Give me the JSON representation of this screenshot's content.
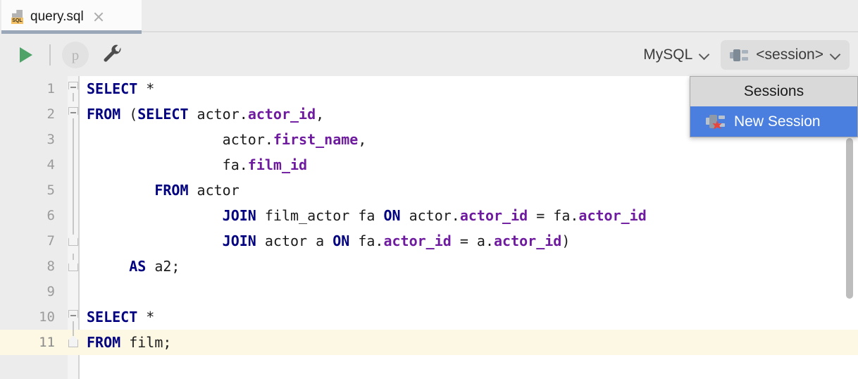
{
  "tab": {
    "filename": "query.sql",
    "icon": "sql-file-icon",
    "badge_text": "SQL",
    "close_icon": "close-icon"
  },
  "toolbar": {
    "run_icon": "run-play-icon",
    "parameters_label": "p",
    "settings_icon": "wrench-icon",
    "dialect_label": "MySQL",
    "dialect_chevron": "chevron-down-icon",
    "session_label": "<session>",
    "session_icon": "session-plug-icon",
    "session_chevron": "chevron-down-icon"
  },
  "dropdown": {
    "header": "Sessions",
    "items": [
      {
        "label": "New Session",
        "icon": "new-session-plug-star-icon",
        "selected": true
      }
    ]
  },
  "editor": {
    "current_line": 11,
    "lines": [
      {
        "n": "1",
        "fold": "minus",
        "tokens": [
          {
            "t": "SELECT",
            "c": "kw"
          },
          {
            "t": " *",
            "c": "pln"
          }
        ]
      },
      {
        "n": "2",
        "fold": "minus",
        "tokens": [
          {
            "t": "FROM",
            "c": "kw"
          },
          {
            "t": " (",
            "c": "pln"
          },
          {
            "t": "SELECT",
            "c": "kw"
          },
          {
            "t": " actor.",
            "c": "pln"
          },
          {
            "t": "actor_id",
            "c": "col"
          },
          {
            "t": ",",
            "c": "pln"
          }
        ]
      },
      {
        "n": "3",
        "fold": "line",
        "tokens": [
          {
            "t": "                actor.",
            "c": "pln"
          },
          {
            "t": "first_name",
            "c": "col"
          },
          {
            "t": ",",
            "c": "pln"
          }
        ]
      },
      {
        "n": "4",
        "fold": "line",
        "tokens": [
          {
            "t": "                fa.",
            "c": "pln"
          },
          {
            "t": "film_id",
            "c": "col"
          }
        ]
      },
      {
        "n": "5",
        "fold": "line",
        "tokens": [
          {
            "t": "        ",
            "c": "pln"
          },
          {
            "t": "FROM",
            "c": "kw"
          },
          {
            "t": " actor",
            "c": "pln"
          }
        ]
      },
      {
        "n": "6",
        "fold": "line",
        "tokens": [
          {
            "t": "                ",
            "c": "pln"
          },
          {
            "t": "JOIN",
            "c": "kw"
          },
          {
            "t": " film_actor fa ",
            "c": "pln"
          },
          {
            "t": "ON",
            "c": "kw"
          },
          {
            "t": " actor.",
            "c": "pln"
          },
          {
            "t": "actor_id",
            "c": "col"
          },
          {
            "t": " = fa.",
            "c": "pln"
          },
          {
            "t": "actor_id",
            "c": "col"
          }
        ]
      },
      {
        "n": "7",
        "fold": "end",
        "tokens": [
          {
            "t": "                ",
            "c": "pln"
          },
          {
            "t": "JOIN",
            "c": "kw"
          },
          {
            "t": " actor a ",
            "c": "pln"
          },
          {
            "t": "ON",
            "c": "kw"
          },
          {
            "t": " fa.",
            "c": "pln"
          },
          {
            "t": "actor_id",
            "c": "col"
          },
          {
            "t": " = a.",
            "c": "pln"
          },
          {
            "t": "actor_id",
            "c": "col"
          },
          {
            "t": ")",
            "c": "pln"
          }
        ]
      },
      {
        "n": "8",
        "fold": "end",
        "tokens": [
          {
            "t": "     ",
            "c": "pln"
          },
          {
            "t": "AS",
            "c": "kw"
          },
          {
            "t": " a2;",
            "c": "pln"
          }
        ]
      },
      {
        "n": "9",
        "fold": "none",
        "tokens": []
      },
      {
        "n": "10",
        "fold": "minus",
        "tokens": [
          {
            "t": "SELECT",
            "c": "kw"
          },
          {
            "t": " *",
            "c": "pln"
          }
        ]
      },
      {
        "n": "11",
        "fold": "end",
        "tokens": [
          {
            "t": "FROM",
            "c": "kw"
          },
          {
            "t": " film;",
            "c": "pln"
          }
        ]
      }
    ]
  },
  "scrollbar": {
    "name": "vertical-scrollbar"
  },
  "colors": {
    "keyword": "#000080",
    "column": "#6f1ba0",
    "current_line_bg": "#fdf8e3",
    "selection_bg": "#4a7fe0",
    "tab_underline": "#9aa7b8",
    "sql_badge": "#f5c164",
    "run_green": "#4fa368",
    "star_red": "#e8453c"
  }
}
